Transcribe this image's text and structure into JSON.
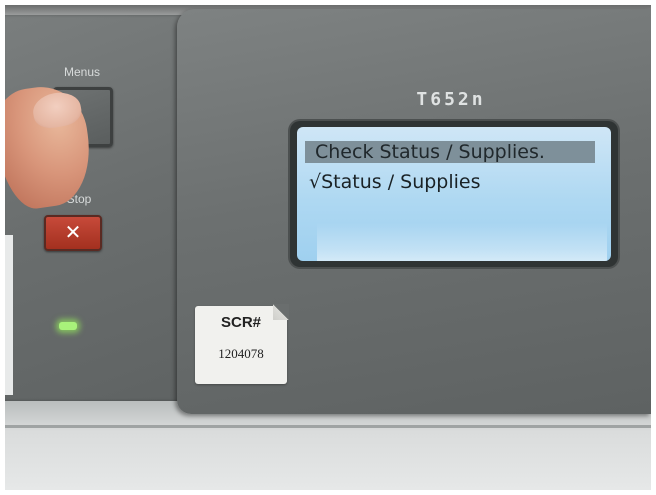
{
  "printer": {
    "model": "T652n"
  },
  "buttons": {
    "menu_label": "Menus",
    "stop_label": "Stop",
    "stop_symbol": "✕"
  },
  "display": {
    "line1": "Check Status / Supplies.",
    "line2": "√Status / Supplies",
    "background_color": "#aed8f2",
    "highlight_color": "#7e909a"
  },
  "sticker": {
    "title": "SCR#",
    "number": "1204078"
  },
  "indicator": {
    "status_light": "on",
    "color": "#a8f27a"
  }
}
